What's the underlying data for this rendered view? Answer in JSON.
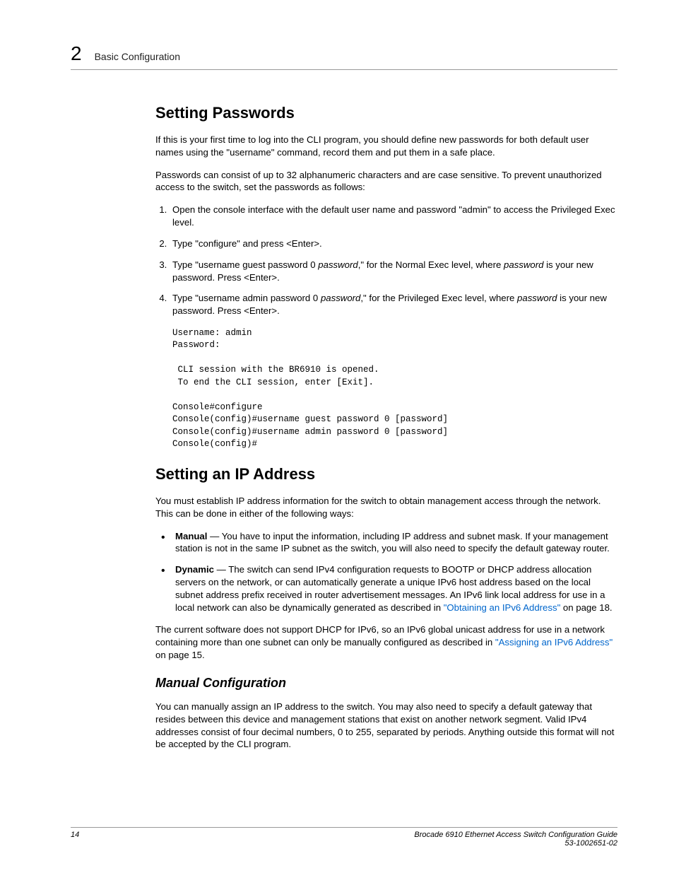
{
  "header": {
    "chapter_num": "2",
    "chapter_title": "Basic Configuration"
  },
  "section1": {
    "heading": "Setting Passwords",
    "p1": "If this is your first time to log into the CLI program, you should define new passwords for both default user names using the \"username\" command, record them and put them in a safe place.",
    "p2": "Passwords can consist of up to 32 alphanumeric characters and are case sensitive. To prevent unauthorized access to the switch, set the passwords as follows:",
    "steps": {
      "s1": "Open the console interface with the default user name and password \"admin\" to access the Privileged Exec level.",
      "s2": "Type \"configure\" and press <Enter>.",
      "s3_a": "Type \"username guest password 0 ",
      "s3_pw": "password",
      "s3_b": ",\" for the Normal Exec level, where ",
      "s3_c": " is your new password. Press <Enter>.",
      "s4_a": "Type \"username admin password 0 ",
      "s4_pw": "password",
      "s4_b": ",\" for the Privileged Exec level, where ",
      "s4_c": " is your new password. Press <Enter>."
    },
    "code": "Username: admin\nPassword:\n\n CLI session with the BR6910 is opened.\n To end the CLI session, enter [Exit].\n\nConsole#configure\nConsole(config)#username guest password 0 [password]\nConsole(config)#username admin password 0 [password]\nConsole(config)#"
  },
  "section2": {
    "heading": "Setting an IP Address",
    "p1": "You must establish IP address information for the switch to obtain management access through the network. This can be done in either of the following ways:",
    "bullets": {
      "b1_label": "Manual",
      "b1_text": " — You have to input the information, including IP address and subnet mask. If your management station is not in the same IP subnet as the switch, you will also need to specify the default gateway router.",
      "b2_label": "Dynamic",
      "b2_text_a": " — The switch can send IPv4 configuration requests to BOOTP or DHCP address allocation servers on the network, or can automatically generate a unique IPv6 host address based on the local subnet address prefix received in router advertisement messages. An IPv6 link local address for use in a local network can also be dynamically generated as described in ",
      "b2_link": "\"Obtaining an IPv6 Address\"",
      "b2_text_b": " on page 18."
    },
    "p2_a": "The current software does not support DHCP for IPv6, so an IPv6 global unicast address for use in a network containing more than one subnet can only be manually configured as described in ",
    "p2_link": "\"Assigning an IPv6 Address\"",
    "p2_b": " on page 15.",
    "sub_heading": "Manual Configuration",
    "p3": "You can manually assign an IP address to the switch. You may also need to specify a default gateway that resides between this device and management stations that exist on another network segment. Valid IPv4 addresses consist of four decimal numbers, 0 to 255, separated by periods. Anything outside this format will not be accepted by the CLI program."
  },
  "footer": {
    "page_num": "14",
    "guide_title": "Brocade 6910 Ethernet Access Switch Configuration Guide",
    "doc_id": "53-1002651-02"
  }
}
